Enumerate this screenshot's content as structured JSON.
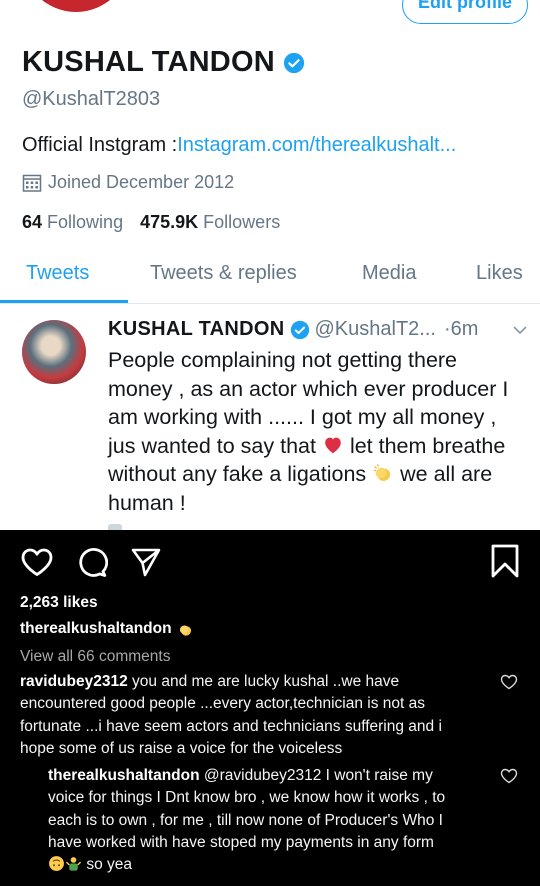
{
  "profile": {
    "edit_label": "Edit profile",
    "name": "KUSHAL TANDON",
    "handle": "@KushalT2803",
    "bio_prefix": "Official Instgram :",
    "bio_link": "Instagram.com/therealkushalt...",
    "joined": "Joined December 2012",
    "following_count": "64",
    "following_label": "Following",
    "followers_count": "475.9K",
    "followers_label": "Followers"
  },
  "tabs": [
    {
      "label": "Tweets",
      "active": true
    },
    {
      "label": "Tweets & replies",
      "active": false
    },
    {
      "label": "Media",
      "active": false
    },
    {
      "label": "Likes",
      "active": false
    }
  ],
  "tweet": {
    "author": "KUSHAL TANDON",
    "handle": "@KushalT2...",
    "time": "·6m",
    "line1": "People complaining not getting there",
    "line2": "money , as an actor which ever producer I",
    "line3": "am working with ...... I got my all money ,",
    "line4a": "jus wanted to say that",
    "line4b": "let them breathe",
    "line5a": "without any fake a ligations",
    "line5b": "we all are",
    "line6": "human !"
  },
  "instagram": {
    "likes": "2,263 likes",
    "owner": "therealkushaltandon",
    "view_all": "View all 66 comments",
    "comment1": {
      "user": "ravidubey2312",
      "line1": "you and me are lucky kushal ..we have",
      "line2": "encountered good people ...every actor,technician is not as",
      "line3": "fortunate ...i have seem actors and technicians suffering and i",
      "line4": "hope some of us raise a voice for the voiceless"
    },
    "comment2": {
      "user": "therealkushaltandon",
      "line1": "@ravidubey2312 I won't raise my",
      "line2": "voice for things I Dnt know bro , we know how it works , to",
      "line3": "each is to own , for me , till now none of Producer's Who I",
      "line4": "have worked with have stoped my payments in any form",
      "line5": "so yea"
    }
  },
  "colors": {
    "twitter_blue": "#1da1f2",
    "twitter_gray": "#657786",
    "instagram_bg": "#000000"
  },
  "icons": [
    "verified-badge-icon",
    "calendar-icon",
    "chevron-down-icon",
    "heart-emoji-icon",
    "clapping-hands-emoji-icon",
    "instagram-heart-icon",
    "comment-icon",
    "share-icon",
    "bookmark-icon",
    "upside-down-face-emoji-icon",
    "person-shrugging-emoji-icon"
  ]
}
